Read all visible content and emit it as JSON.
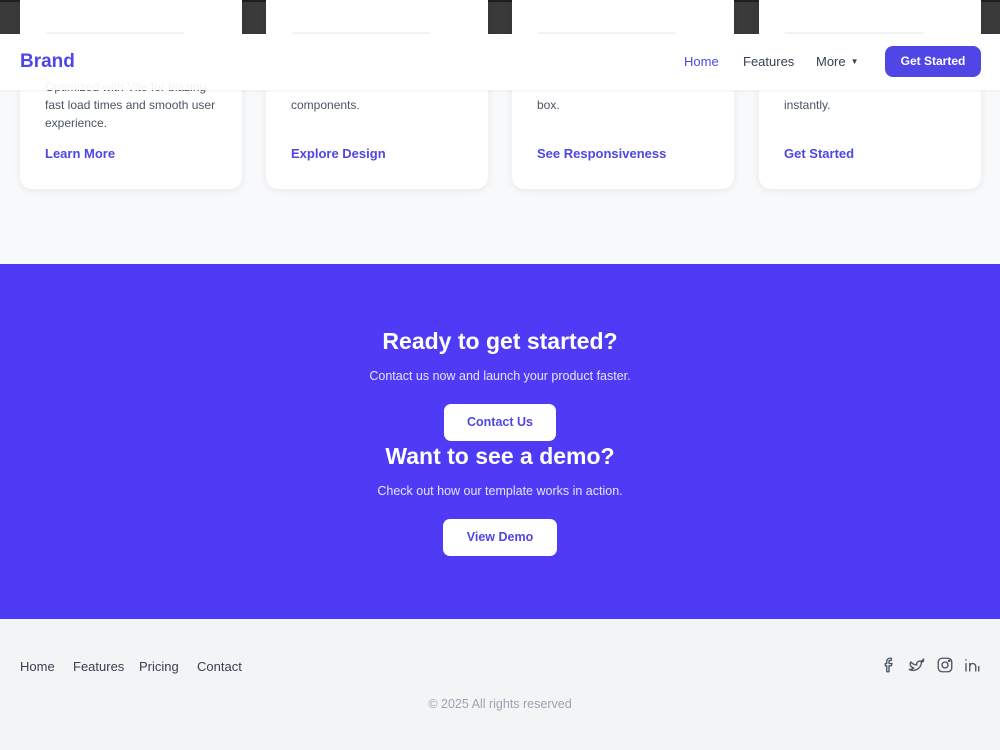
{
  "cards": [
    {
      "body": "Optimized with Vite for blazing-fast load times and smooth user experience.",
      "link": "Learn More"
    },
    {
      "body": "components.",
      "link": "Explore Design"
    },
    {
      "body": "box.",
      "link": "See Responsiveness"
    },
    {
      "body": "instantly.",
      "link": "Get Started"
    }
  ],
  "navbar": {
    "brand": "Brand",
    "links": [
      "Home",
      "Features",
      "More"
    ],
    "cta": "Get Started"
  },
  "cta_sections": [
    {
      "title": "Ready to get started?",
      "text": "Contact us now and launch your product faster.",
      "button": "Contact Us"
    },
    {
      "title": "Want to see a demo?",
      "text": "Check out how our template works in action.",
      "button": "View Demo"
    }
  ],
  "footer": {
    "links": [
      "Home",
      "Features",
      "Pricing",
      "Contact"
    ],
    "social_icons": [
      "facebook-icon",
      "twitter-icon",
      "instagram-icon",
      "linkedin-icon"
    ],
    "copyright": "© 2025 All rights reserved"
  },
  "colors": {
    "accent": "#4f46e5",
    "hero_bg": "#4f3bf5",
    "footer_bg": "#f3f4f6"
  }
}
